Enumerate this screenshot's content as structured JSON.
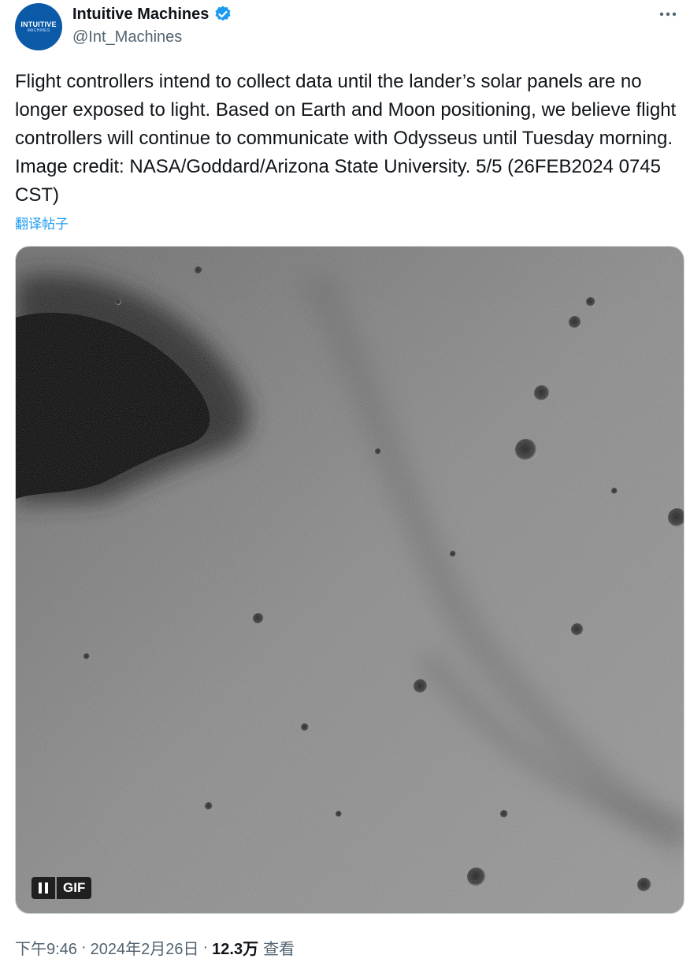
{
  "author": {
    "display_name": "Intuitive Machines",
    "handle": "@Int_Machines",
    "avatar_text": "INTUITIVE",
    "avatar_subtext": "MACHINES",
    "verified_icon": "verified-badge-icon"
  },
  "tweet": {
    "text": "Flight controllers intend to collect data until the lander’s solar panels are no longer exposed to light. Based on Earth and Moon positioning, we believe flight controllers will continue to communicate with Odysseus until Tuesday morning. Image credit: NASA/Goddard/Arizona State University. 5/5 (26FEB2024 0745 CST)",
    "translate_label": "翻译帖子"
  },
  "media": {
    "gif_label": "GIF",
    "pause_icon": "pause-icon"
  },
  "meta": {
    "time": "下午9:46",
    "separator": "·",
    "date": "2024年2月26日",
    "views_count": "12.3万",
    "views_label": "查看"
  },
  "colors": {
    "accent": "#1d9bf0",
    "text": "#0f1419",
    "secondary": "#536471",
    "avatar_bg": "#0a5aa8"
  }
}
